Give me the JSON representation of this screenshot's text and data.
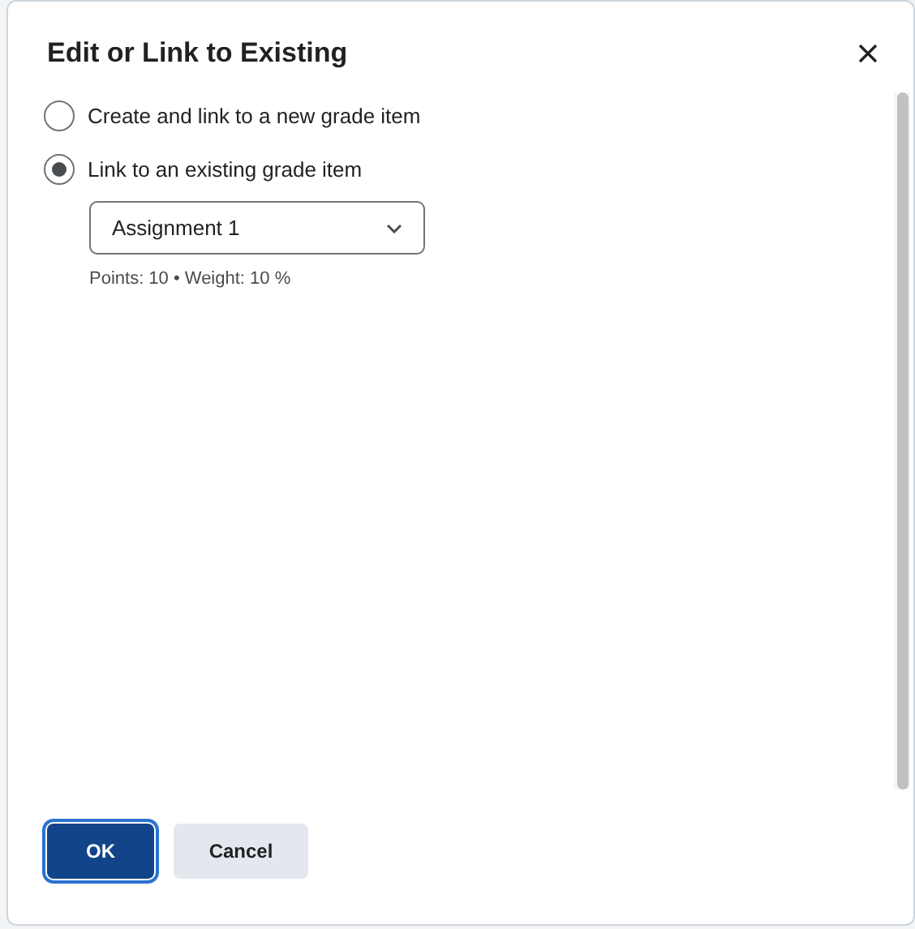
{
  "dialog": {
    "title": "Edit or Link to Existing"
  },
  "options": [
    {
      "label": "Create and link to a new grade item",
      "selected": false
    },
    {
      "label": "Link to an existing grade item",
      "selected": true
    }
  ],
  "grade_item_select": {
    "value": "Assignment 1"
  },
  "grade_item_info": "Points: 10 • Weight: 10 %",
  "buttons": [
    {
      "label": "OK",
      "kind": "primary"
    },
    {
      "label": "Cancel",
      "kind": "secondary"
    }
  ]
}
